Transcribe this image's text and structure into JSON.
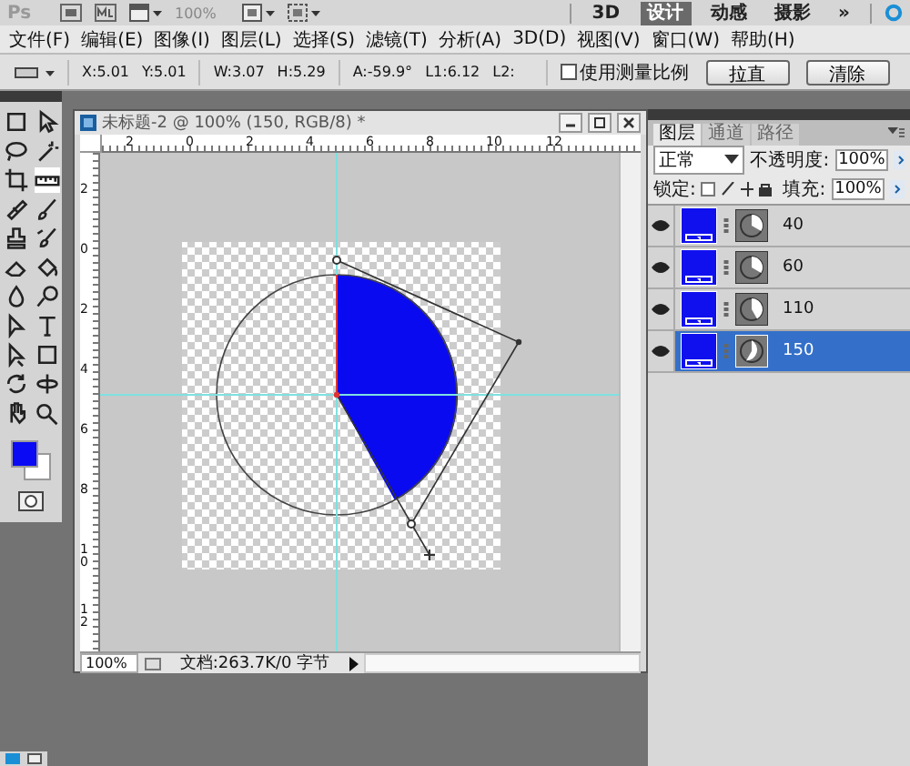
{
  "app_bar": {
    "logo": "Ps",
    "zoom": "100%",
    "workspaces": [
      {
        "label": "3D",
        "selected": false
      },
      {
        "label": "设计",
        "selected": true
      },
      {
        "label": "动感",
        "selected": false
      },
      {
        "label": "摄影",
        "selected": false
      }
    ],
    "more": "»"
  },
  "menu": [
    "文件(F)",
    "编辑(E)",
    "图像(I)",
    "图层(L)",
    "选择(S)",
    "滤镜(T)",
    "分析(A)",
    "3D(D)",
    "视图(V)",
    "窗口(W)",
    "帮助(H)"
  ],
  "options_bar": {
    "fields": [
      {
        "label": "X:",
        "value": "5.01"
      },
      {
        "label": "Y:",
        "value": "5.01"
      },
      {
        "label": "W:",
        "value": "3.07"
      },
      {
        "label": "H:",
        "value": "5.29"
      },
      {
        "label": "A:",
        "value": "-59.9°"
      },
      {
        "label": "L1:",
        "value": "6.12"
      },
      {
        "label": "L2:"
      }
    ],
    "checkbox": {
      "label": "使用测量比例",
      "checked": false
    },
    "buttons": [
      "拉直",
      "清除"
    ]
  },
  "document": {
    "title": "未标题-2 @ 100% (150, RGB/8) *",
    "top_ruler": [
      "2",
      "0",
      "2",
      "4",
      "6",
      "8",
      "10",
      "12"
    ],
    "left_ruler": [
      "2",
      "0",
      "2",
      "4",
      "6",
      "8",
      "10",
      "12"
    ],
    "zoom": "100%",
    "status": "文档:263.7K/0 字节"
  },
  "layers_panel": {
    "tabs": [
      {
        "label": "图层",
        "selected": true
      },
      {
        "label": "通道",
        "selected": false
      },
      {
        "label": "路径",
        "selected": false
      }
    ],
    "blend_mode": "正常",
    "opacity_label": "不透明度:",
    "opacity": "100%",
    "lock_label": "锁定:",
    "fill_label": "填充:",
    "fill": "100%",
    "layers": [
      {
        "name": "40",
        "visible": true,
        "selected": false
      },
      {
        "name": "60",
        "visible": true,
        "selected": false
      },
      {
        "name": "110",
        "visible": true,
        "selected": false
      },
      {
        "name": "150",
        "visible": true,
        "selected": true
      }
    ]
  }
}
